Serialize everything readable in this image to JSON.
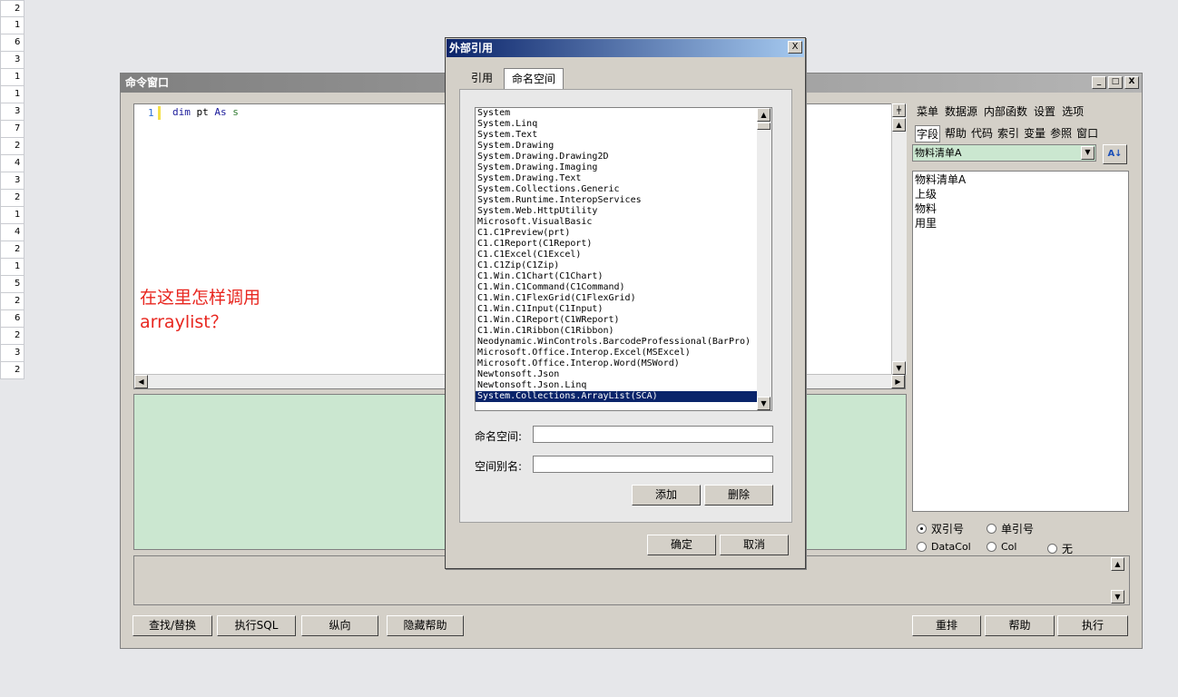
{
  "row_numbers": [
    "2",
    "1",
    "6",
    "3",
    "1",
    "1",
    "3",
    "7",
    "2",
    "4",
    "3",
    "2",
    "1",
    "4",
    "2",
    "1",
    "5",
    "2",
    "6",
    "2",
    "3",
    "2"
  ],
  "cmd_window": {
    "title": "命令窗口",
    "win_buttons": [
      "_",
      "□",
      "X"
    ],
    "editor": {
      "line_no": "1",
      "code": {
        "kw1": "dim",
        "var": "pt",
        "kw2": "As",
        "ty": "s"
      },
      "note_lines": [
        "在这里怎样调用",
        "arraylist？"
      ]
    },
    "right_menu_row1": [
      "菜单",
      "数据源",
      "内部函数",
      "设置",
      "选项"
    ],
    "right_menu_row2": [
      "字段",
      "帮助",
      "代码",
      "索引",
      "变量",
      "参照",
      "窗口"
    ],
    "table_combo": "物料清单A",
    "field_list": [
      "物料清单A",
      "上级",
      "物料",
      "用里"
    ],
    "quote_options": {
      "double": "双引号",
      "single": "单引号"
    },
    "col_options": {
      "datacol": "DataCol",
      "col": "Col",
      "none": "无"
    },
    "bottom_buttons_left": [
      "查找/替换",
      "执行SQL",
      "纵向",
      "隐藏帮助"
    ],
    "bottom_buttons_right": [
      "重排",
      "帮助",
      "执行"
    ]
  },
  "dialog": {
    "title": "外部引用",
    "close": "X",
    "tabs": [
      "引用",
      "命名空间"
    ],
    "namespaces": [
      "System",
      "System.Linq",
      "System.Text",
      "System.Drawing",
      "System.Drawing.Drawing2D",
      "System.Drawing.Imaging",
      "System.Drawing.Text",
      "System.Collections.Generic",
      "System.Runtime.InteropServices",
      "System.Web.HttpUtility",
      "Microsoft.VisualBasic",
      "C1.C1Preview(prt)",
      "C1.C1Report(C1Report)",
      "C1.C1Excel(C1Excel)",
      "C1.C1Zip(C1Zip)",
      "C1.Win.C1Chart(C1Chart)",
      "C1.Win.C1Command(C1Command)",
      "C1.Win.C1FlexGrid(C1FlexGrid)",
      "C1.Win.C1Input(C1Input)",
      "C1.Win.C1Report(C1WReport)",
      "C1.Win.C1Ribbon(C1Ribbon)",
      "Neodynamic.WinControls.BarcodeProfessional(BarPro)",
      "Microsoft.Office.Interop.Excel(MSExcel)",
      "Microsoft.Office.Interop.Word(MSWord)",
      "Newtonsoft.Json",
      "Newtonsoft.Json.Linq",
      "System.Collections.ArrayList(SCA)"
    ],
    "namespace_label": "命名空间:",
    "alias_label": "空间别名:",
    "namespace_value": "",
    "alias_value": "",
    "add_button": "添加",
    "delete_button": "删除",
    "ok_button": "确定",
    "cancel_button": "取消"
  }
}
